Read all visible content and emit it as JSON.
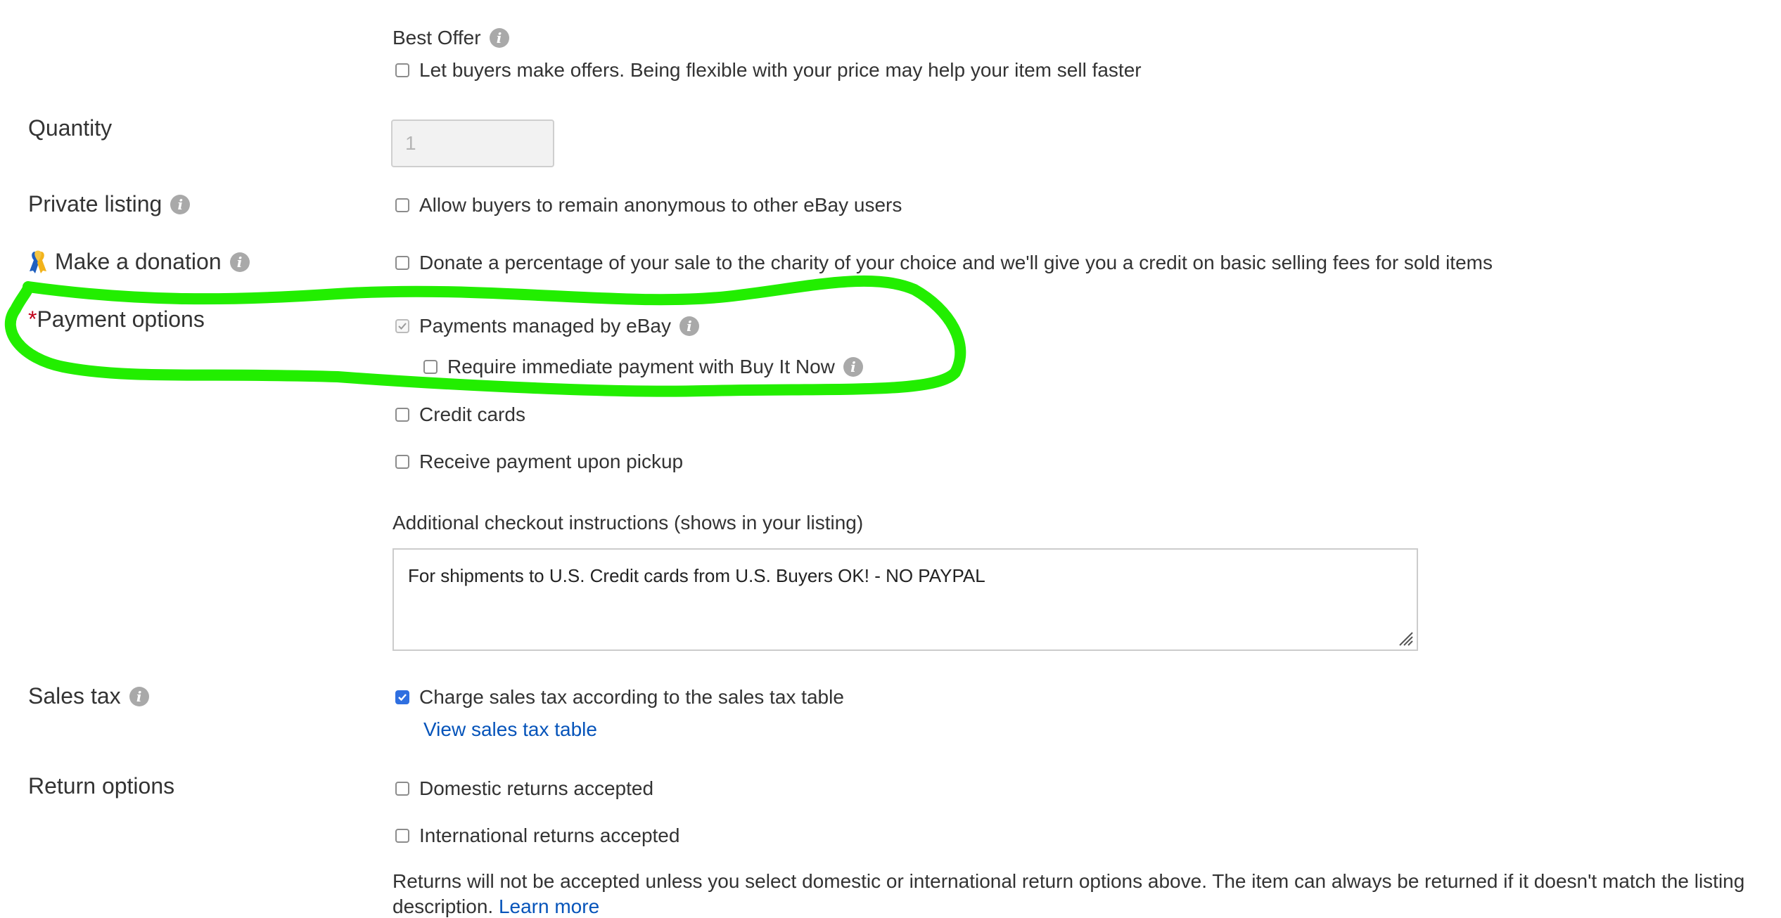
{
  "best_offer": {
    "title": "Best Offer",
    "checkbox_label": "Let buyers make offers. Being flexible with your price may help your item sell faster",
    "checked": false
  },
  "quantity": {
    "label": "Quantity",
    "value": "1"
  },
  "private_listing": {
    "label": "Private listing",
    "checkbox_label": "Allow buyers to remain anonymous to other eBay users",
    "checked": false
  },
  "donation": {
    "label": "Make a donation",
    "checkbox_label": "Donate a percentage of your sale to the charity of your choice and we'll give you a credit on basic selling fees for sold items",
    "checked": false
  },
  "payment_options": {
    "required_mark": "*",
    "label": "Payment options",
    "managed_label": "Payments managed by eBay",
    "managed_checked": true,
    "immediate_label": "Require immediate payment with Buy It Now",
    "immediate_checked": false,
    "credit_cards_label": "Credit cards",
    "pickup_label": "Receive payment upon pickup",
    "checkout_instructions_label": "Additional checkout instructions (shows in your listing)",
    "checkout_instructions_value": "For shipments to U.S. Credit cards from U.S. Buyers OK! - NO PAYPAL"
  },
  "sales_tax": {
    "label": "Sales tax",
    "checkbox_label": "Charge sales tax according to the sales tax table",
    "checked": true,
    "link": "View sales tax table"
  },
  "return_options": {
    "label": "Return options",
    "domestic_label": "Domestic returns accepted",
    "international_label": "International returns accepted",
    "note_line1": "Returns will not be accepted unless you select domestic or international return options above. The item can always be returned if it doesn't match the listing",
    "note_line2": "description.",
    "learn_more": "Learn more"
  },
  "info_glyph": "i",
  "colors": {
    "highlight": "#22ee00",
    "link": "#0654ba",
    "checked": "#2f6fe0",
    "required": "#c0001a"
  },
  "icons": [
    "info-icon",
    "ribbon-icon",
    "checkmark-icon",
    "resize-grip-icon"
  ]
}
